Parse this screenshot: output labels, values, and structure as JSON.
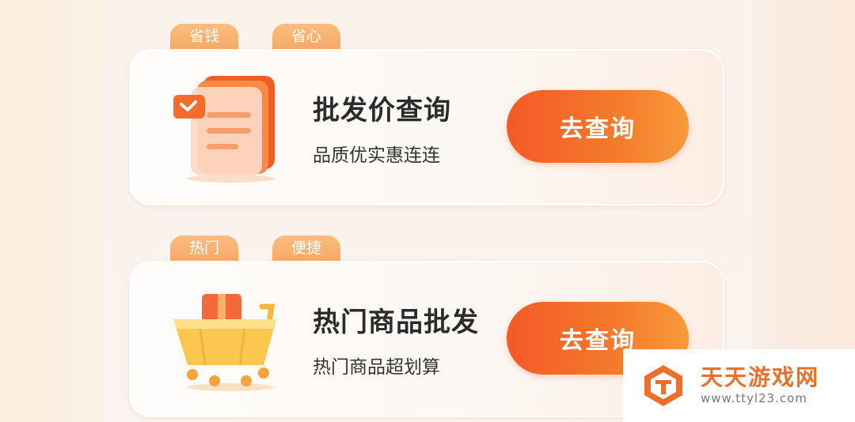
{
  "cards": [
    {
      "tags": [
        "省钱",
        "省心"
      ],
      "title": "批发价查询",
      "subtitle": "品质优实惠连连",
      "button": "去查询",
      "icon": "document-list-icon"
    },
    {
      "tags": [
        "热门",
        "便捷"
      ],
      "title": "热门商品批发",
      "subtitle": "热门商品超划算",
      "button": "去查询",
      "icon": "shopping-cart-gift-icon"
    }
  ],
  "watermark": {
    "name": "天天游戏网",
    "url": "www.ttyl23.com"
  },
  "colors": {
    "accent": "#f45a26",
    "tag": "#f8b070",
    "watermark": "#ef6f2a"
  }
}
